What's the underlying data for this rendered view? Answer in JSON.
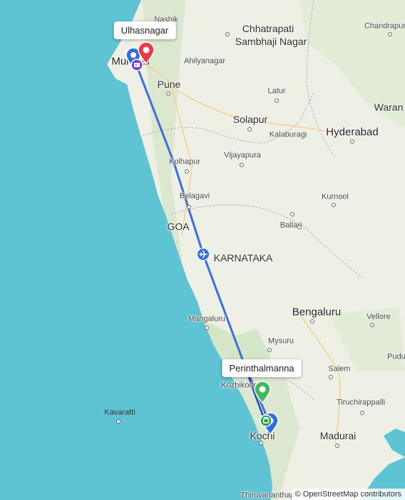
{
  "map": {
    "attribution": "© OpenStreetMap contributors",
    "places": [
      {
        "name": "Nashik",
        "size": "sm"
      },
      {
        "name": "Chhatrapati",
        "size": "med"
      },
      {
        "name": "Sambhaji Nagar",
        "size": "med"
      },
      {
        "name": "Chandrapur",
        "size": "sm"
      },
      {
        "name": "Ahilyanagar",
        "size": "sm"
      },
      {
        "name": "Pune",
        "size": "med"
      },
      {
        "name": "Latur",
        "size": "sm"
      },
      {
        "name": "Waran",
        "size": "med"
      },
      {
        "name": "Solapur",
        "size": "med"
      },
      {
        "name": "Kalaburagi",
        "size": "sm"
      },
      {
        "name": "Hyderabad",
        "size": "big"
      },
      {
        "name": "Kolhapur",
        "size": "sm"
      },
      {
        "name": "Vijayapura",
        "size": "sm"
      },
      {
        "name": "Belagavi",
        "size": "sm"
      },
      {
        "name": "Kurnool",
        "size": "sm"
      },
      {
        "name": "GOA",
        "size": "med"
      },
      {
        "name": "Ballari",
        "size": "sm"
      },
      {
        "name": "KARNATAKA",
        "size": "med"
      },
      {
        "name": "Mangaluru",
        "size": "sm"
      },
      {
        "name": "Bengaluru",
        "size": "big"
      },
      {
        "name": "Vellore",
        "size": "sm"
      },
      {
        "name": "Mysuru",
        "size": "sm"
      },
      {
        "name": "Salem",
        "size": "sm"
      },
      {
        "name": "Kozhikode",
        "size": "sm"
      },
      {
        "name": "Tiruchirappalli",
        "size": "sm"
      },
      {
        "name": "Kochi",
        "size": "med"
      },
      {
        "name": "Madurai",
        "size": "med"
      },
      {
        "name": "Kavaratti",
        "size": "sm"
      },
      {
        "name": "Thiruvananthapuram",
        "size": "sm"
      },
      {
        "name": "Mumbai",
        "size": "big"
      },
      {
        "name": "Pudu",
        "size": "sm"
      }
    ],
    "callouts": {
      "origin": "Ulhasnagar",
      "destination": "Perinthalmanna"
    },
    "colors": {
      "route": "#3b6fe0",
      "origin_pin": "#ea3a45",
      "destination_pin": "#3fb95a",
      "waypoint": "#2f6de0",
      "sea": "#5ec4d3",
      "land": "#eef0e6"
    },
    "icons": [
      "airplane-icon",
      "hotel-icon",
      "restaurant-icon",
      "location-pin-icon"
    ]
  }
}
